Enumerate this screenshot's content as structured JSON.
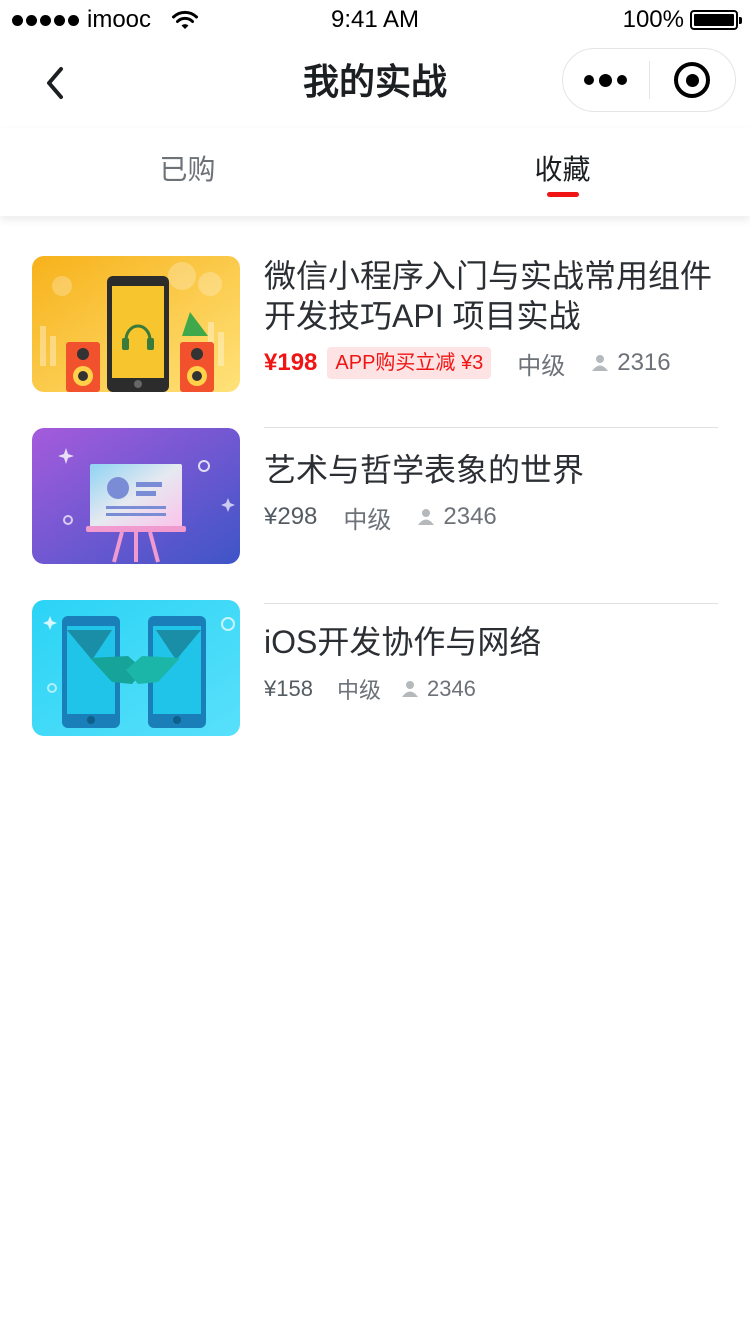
{
  "status_bar": {
    "carrier": "imooc",
    "time": "9:41 AM",
    "battery": "100%"
  },
  "nav": {
    "title": "我的实战"
  },
  "tabs": [
    {
      "label": "已购",
      "active": false
    },
    {
      "label": "收藏",
      "active": true
    }
  ],
  "courses": [
    {
      "title": "微信小程序入门与实战常用组件开发技巧API  项目实战",
      "price": "¥198",
      "promo": "APP购买立减 ¥3",
      "level": "中级",
      "students": "2316",
      "thumb_icon": "music-phone-illustration",
      "price_color": "#f01414"
    },
    {
      "title": "艺术与哲学表象的世界",
      "price": "¥298",
      "level": "中级",
      "students": "2346",
      "thumb_icon": "presentation-board-illustration"
    },
    {
      "title": "iOS开发协作与网络",
      "price": "¥158",
      "level": "中级",
      "students": "2346",
      "thumb_icon": "phones-handshake-illustration"
    }
  ],
  "colors": {
    "accent": "#f01414",
    "promo_bg": "#fde3e3",
    "text": "#1c1f21",
    "secondary": "#6d7278"
  }
}
